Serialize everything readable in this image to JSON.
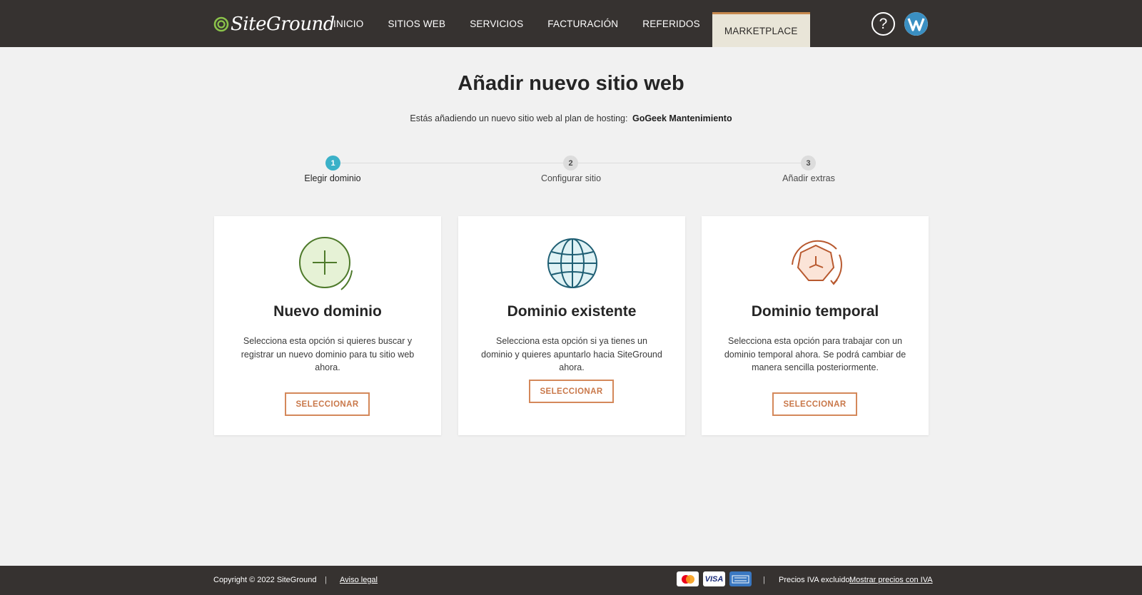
{
  "header": {
    "logo_text": "SiteGround",
    "nav": [
      "INICIO",
      "SITIOS WEB",
      "SERVICIOS",
      "FACTURACIÓN",
      "REFERIDOS",
      "MARKETPLACE"
    ],
    "active_nav": "MARKETPLACE",
    "help_icon": "?"
  },
  "page": {
    "title": "Añadir nuevo sitio web",
    "plan_prefix": "Estás añadiendo un nuevo sitio web al plan de hosting:",
    "plan_name": "GoGeek Mantenimiento"
  },
  "stepper": {
    "steps": [
      {
        "number": "1",
        "label": "Elegir dominio",
        "active": true
      },
      {
        "number": "2",
        "label": "Configurar sitio",
        "active": false
      },
      {
        "number": "3",
        "label": "Añadir extras",
        "active": false
      }
    ]
  },
  "cards": [
    {
      "icon": "plus-circle-icon",
      "title": "Nuevo dominio",
      "description": "Selecciona esta opción si quieres buscar y registrar un nuevo dominio para tu sitio web ahora.",
      "button": "SELECCIONAR"
    },
    {
      "icon": "globe-icon",
      "title": "Dominio existente",
      "description": "Selecciona esta opción si ya tienes un dominio y quieres apuntarlo hacia SiteGround ahora.",
      "button": "SELECCIONAR"
    },
    {
      "icon": "clock-icon",
      "title": "Dominio temporal",
      "description": "Selecciona esta opción para trabajar con un dominio temporal ahora. Se podrá cambiar de manera sencilla posteriormente.",
      "button": "SELECCIONAR"
    }
  ],
  "footer": {
    "copyright": "Copyright © 2022 SiteGround",
    "separator": "|",
    "legal_link": "Aviso legal",
    "payment_methods": [
      "mastercard-icon",
      "visa-icon",
      "amex-icon"
    ],
    "visa_text": "VISA",
    "vat_text": "Precios IVA excluido.",
    "vat_link": "Mostrar precios con IVA"
  },
  "colors": {
    "header_bg": "#363230",
    "active_tab_bg": "#e9e5d8",
    "accent_orange": "#d4885a",
    "step_active": "#3bb1c8"
  }
}
